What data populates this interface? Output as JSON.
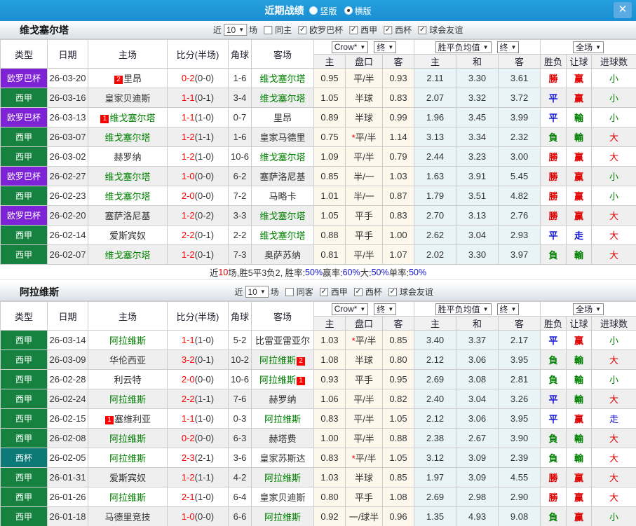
{
  "titlebar": {
    "title": "近期战绩",
    "radio_vertical": "竖版",
    "radio_horizontal": "横版",
    "close": "✕"
  },
  "columns": {
    "type": "类型",
    "date": "日期",
    "home": "主场",
    "score": "比分(半场)",
    "corner": "角球",
    "away": "客场",
    "h": "主",
    "line": "盘口",
    "a": "客",
    "eh": "主",
    "ed": "和",
    "ea": "客",
    "wdl": "胜负",
    "handicap": "让球",
    "goals": "进球数"
  },
  "dropdowns": {
    "company": "Crow*",
    "final1": "终",
    "avg": "胜平负均值",
    "final2": "终",
    "scope": "全场"
  },
  "filter_labels": {
    "near": "近",
    "games": "10",
    "suffix": "场"
  },
  "result_colors": {
    "勝": "r",
    "平": "b",
    "負": "g",
    "赢": "r",
    "輸": "g",
    "走": "b",
    "大": "r",
    "小": "g"
  },
  "type_colors": {
    "欧罗巴杯": "t-eu",
    "西甲": "t-lg",
    "西杯": "t-cup"
  },
  "colors": {
    "topbar": "#1b8fd2",
    "europa_purple": "#7d22d4",
    "laliga_green": "#17813f",
    "copa_teal": "#0e7a78",
    "focal_team_green": "#008000",
    "score_red": "#ff0000",
    "ah_bg": "#fdf7ec",
    "eu_bg": "#e9f4f9"
  },
  "sections": [
    {
      "team": "维戈塞尔塔",
      "same_label": "同主",
      "leagues": [
        {
          "label": "欧罗巴杯",
          "checked": true
        },
        {
          "label": "西甲",
          "checked": true
        },
        {
          "label": "西杯",
          "checked": true
        },
        {
          "label": "球会友谊",
          "checked": true
        }
      ],
      "rows": [
        {
          "type": "欧罗巴杯",
          "date": "26-03-20",
          "home": "里昂",
          "hg": false,
          "hb": "2",
          "ft": "0-2",
          "ht": "(0-0)",
          "corner": "1-6",
          "away": "维戈塞尔塔",
          "ag": true,
          "ab": "",
          "ahh": "0.95",
          "line": "平/半",
          "aha": "0.93",
          "eh": "2.11",
          "ed": "3.30",
          "ea": "3.61",
          "wdl": "勝",
          "hc": "赢",
          "gl": "小"
        },
        {
          "type": "西甲",
          "date": "26-03-16",
          "home": "皇家贝迪斯",
          "hg": false,
          "hb": "",
          "ft": "1-1",
          "ht": "(0-1)",
          "corner": "3-4",
          "away": "维戈塞尔塔",
          "ag": true,
          "ab": "",
          "ahh": "1.05",
          "line": "半球",
          "aha": "0.83",
          "eh": "2.07",
          "ed": "3.32",
          "ea": "3.72",
          "wdl": "平",
          "hc": "赢",
          "gl": "小"
        },
        {
          "type": "欧罗巴杯",
          "date": "26-03-13",
          "home": "维戈塞尔塔",
          "hg": true,
          "hb": "1",
          "ft": "1-1",
          "ht": "(1-0)",
          "corner": "0-7",
          "away": "里昂",
          "ag": false,
          "ab": "",
          "ahh": "0.89",
          "line": "半球",
          "aha": "0.99",
          "eh": "1.96",
          "ed": "3.45",
          "ea": "3.99",
          "wdl": "平",
          "hc": "輸",
          "gl": "小"
        },
        {
          "type": "西甲",
          "date": "26-03-07",
          "home": "维戈塞尔塔",
          "hg": true,
          "hb": "",
          "ft": "1-2",
          "ht": "(1-1)",
          "corner": "1-6",
          "away": "皇家马德里",
          "ag": false,
          "ab": "",
          "ahh": "0.75",
          "line": "*平/半",
          "aha": "1.14",
          "eh": "3.13",
          "ed": "3.34",
          "ea": "2.32",
          "wdl": "負",
          "hc": "輸",
          "gl": "大"
        },
        {
          "type": "西甲",
          "date": "26-03-02",
          "home": "赫罗纳",
          "hg": false,
          "hb": "",
          "ft": "1-2",
          "ht": "(1-0)",
          "corner": "10-6",
          "away": "维戈塞尔塔",
          "ag": true,
          "ab": "",
          "ahh": "1.09",
          "line": "平/半",
          "aha": "0.79",
          "eh": "2.44",
          "ed": "3.23",
          "ea": "3.00",
          "wdl": "勝",
          "hc": "赢",
          "gl": "大"
        },
        {
          "type": "欧罗巴杯",
          "date": "26-02-27",
          "home": "维戈塞尔塔",
          "hg": true,
          "hb": "",
          "ft": "1-0",
          "ht": "(0-0)",
          "corner": "6-2",
          "away": "塞萨洛尼基",
          "ag": false,
          "ab": "",
          "ahh": "0.85",
          "line": "半/一",
          "aha": "1.03",
          "eh": "1.63",
          "ed": "3.91",
          "ea": "5.45",
          "wdl": "勝",
          "hc": "赢",
          "gl": "小"
        },
        {
          "type": "西甲",
          "date": "26-02-23",
          "home": "维戈塞尔塔",
          "hg": true,
          "hb": "",
          "ft": "2-0",
          "ht": "(0-0)",
          "corner": "7-2",
          "away": "马略卡",
          "ag": false,
          "ab": "",
          "ahh": "1.01",
          "line": "半/一",
          "aha": "0.87",
          "eh": "1.79",
          "ed": "3.51",
          "ea": "4.82",
          "wdl": "勝",
          "hc": "赢",
          "gl": "小"
        },
        {
          "type": "欧罗巴杯",
          "date": "26-02-20",
          "home": "塞萨洛尼基",
          "hg": false,
          "hb": "",
          "ft": "1-2",
          "ht": "(0-2)",
          "corner": "3-3",
          "away": "维戈塞尔塔",
          "ag": true,
          "ab": "",
          "ahh": "1.05",
          "line": "平手",
          "aha": "0.83",
          "eh": "2.70",
          "ed": "3.13",
          "ea": "2.76",
          "wdl": "勝",
          "hc": "赢",
          "gl": "大"
        },
        {
          "type": "西甲",
          "date": "26-02-14",
          "home": "爱斯宾奴",
          "hg": false,
          "hb": "",
          "ft": "2-2",
          "ht": "(0-1)",
          "corner": "2-2",
          "away": "维戈塞尔塔",
          "ag": true,
          "ab": "",
          "ahh": "0.88",
          "line": "平手",
          "aha": "1.00",
          "eh": "2.62",
          "ed": "3.04",
          "ea": "2.93",
          "wdl": "平",
          "hc": "走",
          "gl": "大"
        },
        {
          "type": "西甲",
          "date": "26-02-07",
          "home": "维戈塞尔塔",
          "hg": true,
          "hb": "",
          "ft": "1-2",
          "ht": "(0-1)",
          "corner": "7-3",
          "away": "奥萨苏纳",
          "ag": false,
          "ab": "",
          "ahh": "0.81",
          "line": "平/半",
          "aha": "1.07",
          "eh": "2.02",
          "ed": "3.30",
          "ea": "3.97",
          "wdl": "負",
          "hc": "輸",
          "gl": "大"
        }
      ],
      "summary": [
        {
          "t": "近",
          "c": "k"
        },
        {
          "t": "10",
          "c": "r"
        },
        {
          "t": "场,胜5平3负2, 胜率:",
          "c": "k"
        },
        {
          "t": "50%",
          "c": "b"
        },
        {
          "t": " 赢率:",
          "c": "k"
        },
        {
          "t": "60%",
          "c": "b"
        },
        {
          "t": " 大:",
          "c": "k"
        },
        {
          "t": "50%",
          "c": "b"
        },
        {
          "t": " 单率:",
          "c": "k"
        },
        {
          "t": "50%",
          "c": "b"
        }
      ]
    },
    {
      "team": "阿拉维斯",
      "same_label": "同客",
      "leagues": [
        {
          "label": "西甲",
          "checked": true
        },
        {
          "label": "西杯",
          "checked": true
        },
        {
          "label": "球会友谊",
          "checked": true
        }
      ],
      "rows": [
        {
          "type": "西甲",
          "date": "26-03-14",
          "home": "阿拉维斯",
          "hg": true,
          "hb": "",
          "ft": "1-1",
          "ht": "(1-0)",
          "corner": "5-2",
          "away": "比雷亚雷亚尔",
          "ag": false,
          "ab": "",
          "ahh": "1.03",
          "line": "*平/半",
          "aha": "0.85",
          "eh": "3.40",
          "ed": "3.37",
          "ea": "2.17",
          "wdl": "平",
          "hc": "赢",
          "gl": "小"
        },
        {
          "type": "西甲",
          "date": "26-03-09",
          "home": "华伦西亚",
          "hg": false,
          "hb": "",
          "ft": "3-2",
          "ht": "(0-1)",
          "corner": "10-2",
          "away": "阿拉维斯",
          "ag": true,
          "ab": "2",
          "ahh": "1.08",
          "line": "半球",
          "aha": "0.80",
          "eh": "2.12",
          "ed": "3.06",
          "ea": "3.95",
          "wdl": "負",
          "hc": "輸",
          "gl": "大"
        },
        {
          "type": "西甲",
          "date": "26-02-28",
          "home": "利云特",
          "hg": false,
          "hb": "",
          "ft": "2-0",
          "ht": "(0-0)",
          "corner": "10-6",
          "away": "阿拉维斯",
          "ag": true,
          "ab": "1",
          "ahh": "0.93",
          "line": "平手",
          "aha": "0.95",
          "eh": "2.69",
          "ed": "3.08",
          "ea": "2.81",
          "wdl": "負",
          "hc": "輸",
          "gl": "小"
        },
        {
          "type": "西甲",
          "date": "26-02-24",
          "home": "阿拉维斯",
          "hg": true,
          "hb": "",
          "ft": "2-2",
          "ht": "(1-1)",
          "corner": "7-6",
          "away": "赫罗纳",
          "ag": false,
          "ab": "",
          "ahh": "1.06",
          "line": "平/半",
          "aha": "0.82",
          "eh": "2.40",
          "ed": "3.04",
          "ea": "3.26",
          "wdl": "平",
          "hc": "輸",
          "gl": "大"
        },
        {
          "type": "西甲",
          "date": "26-02-15",
          "home": "塞维利亚",
          "hg": false,
          "hb": "1",
          "ft": "1-1",
          "ht": "(1-0)",
          "corner": "0-3",
          "away": "阿拉维斯",
          "ag": true,
          "ab": "",
          "ahh": "0.83",
          "line": "平/半",
          "aha": "1.05",
          "eh": "2.12",
          "ed": "3.06",
          "ea": "3.95",
          "wdl": "平",
          "hc": "赢",
          "gl": "走"
        },
        {
          "type": "西甲",
          "date": "26-02-08",
          "home": "阿拉维斯",
          "hg": true,
          "hb": "",
          "ft": "0-2",
          "ht": "(0-0)",
          "corner": "6-3",
          "away": "赫塔费",
          "ag": false,
          "ab": "",
          "ahh": "1.00",
          "line": "平/半",
          "aha": "0.88",
          "eh": "2.38",
          "ed": "2.67",
          "ea": "3.90",
          "wdl": "負",
          "hc": "輸",
          "gl": "大"
        },
        {
          "type": "西杯",
          "date": "26-02-05",
          "home": "阿拉维斯",
          "hg": true,
          "hb": "",
          "ft": "2-3",
          "ht": "(2-1)",
          "corner": "3-6",
          "away": "皇家苏斯达",
          "ag": false,
          "ab": "",
          "ahh": "0.83",
          "line": "*平/半",
          "aha": "1.05",
          "eh": "3.12",
          "ed": "3.09",
          "ea": "2.39",
          "wdl": "負",
          "hc": "輸",
          "gl": "大"
        },
        {
          "type": "西甲",
          "date": "26-01-31",
          "home": "爱斯宾奴",
          "hg": false,
          "hb": "",
          "ft": "1-2",
          "ht": "(1-1)",
          "corner": "4-2",
          "away": "阿拉维斯",
          "ag": true,
          "ab": "",
          "ahh": "1.03",
          "line": "半球",
          "aha": "0.85",
          "eh": "1.97",
          "ed": "3.09",
          "ea": "4.55",
          "wdl": "勝",
          "hc": "赢",
          "gl": "大"
        },
        {
          "type": "西甲",
          "date": "26-01-26",
          "home": "阿拉维斯",
          "hg": true,
          "hb": "",
          "ft": "2-1",
          "ht": "(1-0)",
          "corner": "6-4",
          "away": "皇家贝迪斯",
          "ag": false,
          "ab": "",
          "ahh": "0.80",
          "line": "平手",
          "aha": "1.08",
          "eh": "2.69",
          "ed": "2.98",
          "ea": "2.90",
          "wdl": "勝",
          "hc": "赢",
          "gl": "大"
        },
        {
          "type": "西甲",
          "date": "26-01-18",
          "home": "马德里竞技",
          "hg": false,
          "hb": "",
          "ft": "1-0",
          "ht": "(0-0)",
          "corner": "6-6",
          "away": "阿拉维斯",
          "ag": true,
          "ab": "",
          "ahh": "0.92",
          "line": "一/球半",
          "aha": "0.96",
          "eh": "1.35",
          "ed": "4.93",
          "ea": "9.08",
          "wdl": "負",
          "hc": "赢",
          "gl": "小"
        }
      ],
      "summary": null
    }
  ]
}
